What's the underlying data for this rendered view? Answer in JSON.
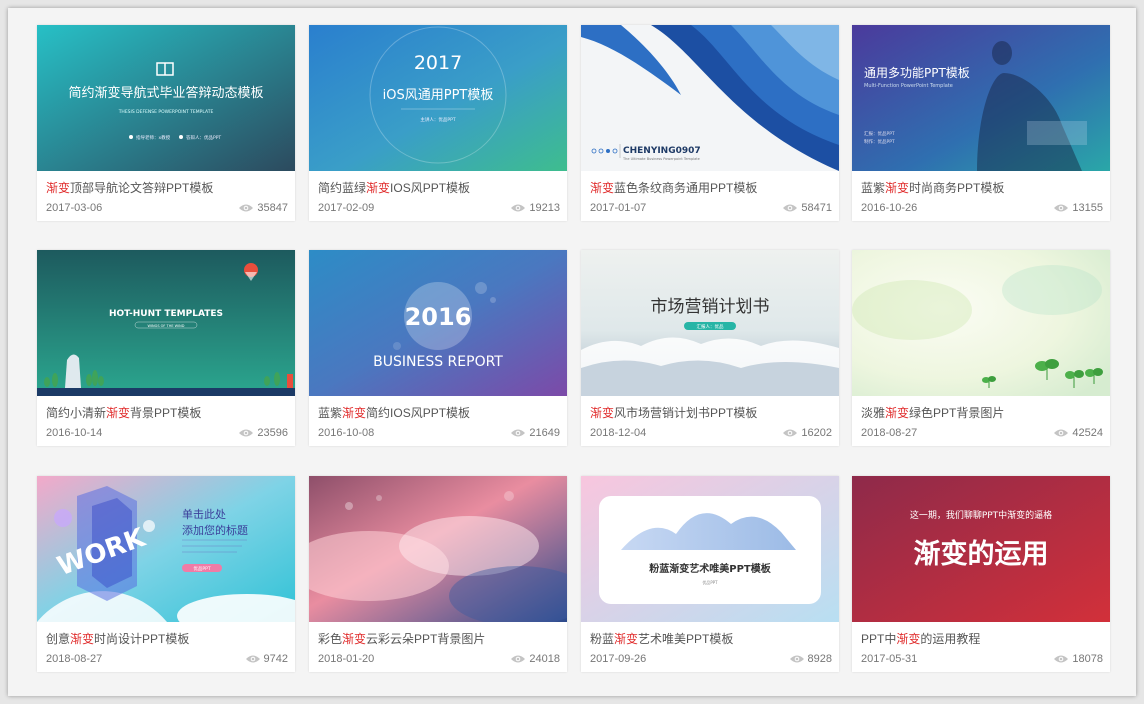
{
  "cards": [
    {
      "title_pre": "",
      "title_hl": "渐变",
      "title_post": "顶部导航论文答辩PPT模板",
      "date": "2017-03-06",
      "views": "35847",
      "thumb": {
        "heading": "简约渐变导航式毕业答辩动态模板",
        "sub": "THESIS DEFENSE POWERPOINT TEMPLATE",
        "note1": "指导老师：x教授",
        "note2": "答辩人：优品PPT"
      }
    },
    {
      "title_pre": "简约蓝绿",
      "title_hl": "渐变",
      "title_post": "IOS风PPT模板",
      "date": "2017-02-09",
      "views": "19213",
      "thumb": {
        "year": "2017",
        "heading": "iOS风通用PPT模板",
        "note": "主讲人：优品PPT"
      }
    },
    {
      "title_pre": "",
      "title_hl": "渐变",
      "title_post": "蓝色条纹商务通用PPT模板",
      "date": "2017-01-07",
      "views": "58471",
      "thumb": {
        "brand": "CHENYING0907",
        "sub": "The Ultimate Business Powerpoint Template"
      }
    },
    {
      "title_pre": "蓝紫",
      "title_hl": "渐变",
      "title_post": "时尚商务PPT模板",
      "date": "2016-10-26",
      "views": "13155",
      "thumb": {
        "heading": "通用多功能PPT模板",
        "sub": "Multi-Function PowerPoint Template",
        "note1": "汇报：优品PPT",
        "note2": "制作：优品PPT"
      }
    },
    {
      "title_pre": "简约小清新",
      "title_hl": "渐变",
      "title_post": "背景PPT模板",
      "date": "2016-10-14",
      "views": "23596",
      "thumb": {
        "heading": "HOT-HUNT TEMPLATES",
        "sub": "WINGS OF THE WIND"
      }
    },
    {
      "title_pre": "蓝紫",
      "title_hl": "渐变",
      "title_post": "简约IOS风PPT模板",
      "date": "2016-10-08",
      "views": "21649",
      "thumb": {
        "year": "2016",
        "heading": "BUSINESS REPORT"
      }
    },
    {
      "title_pre": "",
      "title_hl": "渐变",
      "title_post": "风市场营销计划书PPT模板",
      "date": "2018-12-04",
      "views": "16202",
      "thumb": {
        "heading": "市场营销计划书",
        "tag": "汇报人：优品"
      }
    },
    {
      "title_pre": "淡雅",
      "title_hl": "渐变",
      "title_post": "绿色PPT背景图片",
      "date": "2018-08-27",
      "views": "42524",
      "thumb": {}
    },
    {
      "title_pre": "创意",
      "title_hl": "渐变",
      "title_post": "时尚设计PPT模板",
      "date": "2018-08-27",
      "views": "9742",
      "thumb": {
        "word": "WORK",
        "heading1": "单击此处",
        "heading2": "添加您的标题",
        "button": "优品PPT"
      }
    },
    {
      "title_pre": "彩色",
      "title_hl": "渐变",
      "title_post": "云彩云朵PPT背景图片",
      "date": "2018-01-20",
      "views": "24018",
      "thumb": {}
    },
    {
      "title_pre": "粉蓝",
      "title_hl": "渐变",
      "title_post": "艺术唯美PPT模板",
      "date": "2017-09-26",
      "views": "8928",
      "thumb": {
        "heading": "粉蓝渐变艺术唯美PPT模板",
        "note": "优品PPT"
      }
    },
    {
      "title_pre": "PPT中",
      "title_hl": "渐变",
      "title_post": "的运用教程",
      "date": "2017-05-31",
      "views": "18078",
      "thumb": {
        "sub": "这一期，我们聊聊PPT中渐变的逼格",
        "heading": "渐变的运用"
      }
    }
  ],
  "colors": {
    "highlight": "#e02b2b",
    "text": "#555555",
    "meta": "#777777"
  }
}
